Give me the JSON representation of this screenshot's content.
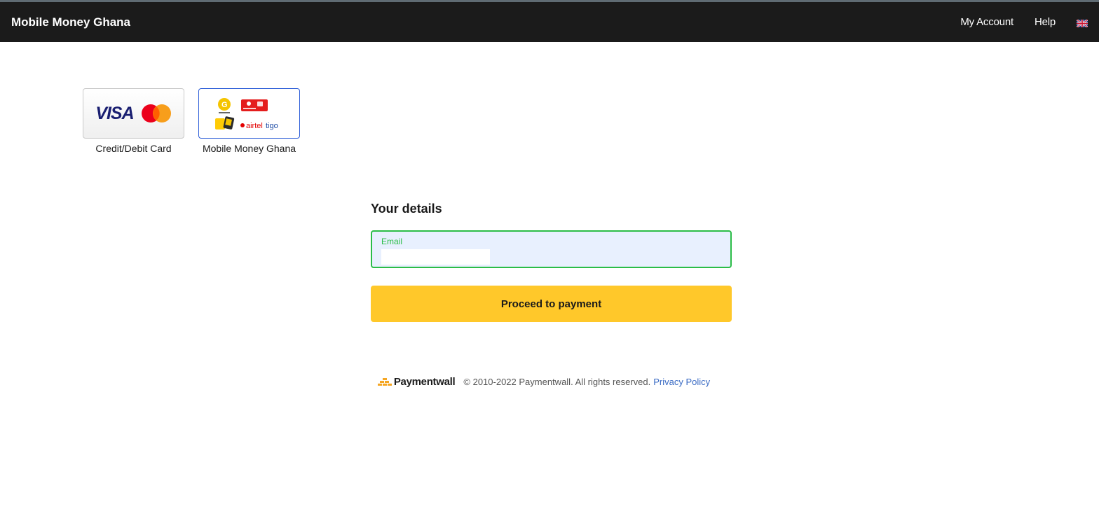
{
  "header": {
    "brand": "Mobile Money Ghana",
    "nav": {
      "my_account": "My Account",
      "help": "Help",
      "language_icon": "uk-flag-icon"
    }
  },
  "methods": [
    {
      "label": "Credit/Debit Card",
      "logo_text": "VISA",
      "selected": false
    },
    {
      "label": "Mobile Money Ghana",
      "logo_text": "airteltigo",
      "selected": true
    }
  ],
  "details": {
    "title": "Your details",
    "email_label": "Email",
    "email_value": "",
    "proceed_label": "Proceed to payment"
  },
  "footer": {
    "brand": "Paymentwall",
    "copyright": "© 2010-2022 Paymentwall. All rights reserved.",
    "privacy_link": "Privacy Policy"
  },
  "colors": {
    "header_bg": "#1b1b1b",
    "accent_button": "#ffc82a",
    "field_border": "#2bbd47",
    "selected_border": "#2a5bd7",
    "link": "#3a6bc4"
  }
}
